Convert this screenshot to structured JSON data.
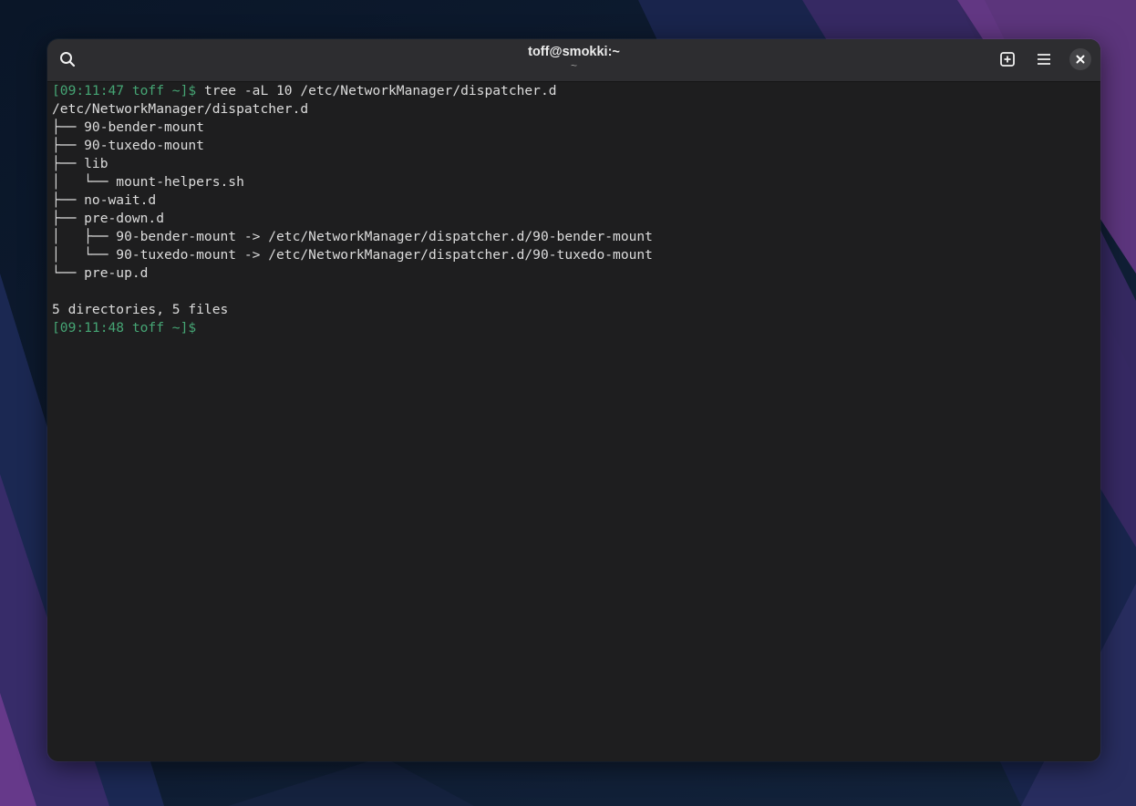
{
  "window": {
    "title": "toff@smokki:~",
    "subtitle": "~"
  },
  "titlebar": {
    "icons": [
      "search-icon",
      "new-tab-icon",
      "hamburger-menu-icon",
      "close-icon"
    ]
  },
  "colors": {
    "terminal_bg": "#1e1e1f",
    "terminal_fg": "#dcdcdc",
    "prompt": "#45a574",
    "headerbar": "#2d2d30"
  },
  "terminal": {
    "prompt1": "[09:11:47 toff ~]$",
    "command": " tree -aL 10 /etc/NetworkManager/dispatcher.d",
    "output": [
      "/etc/NetworkManager/dispatcher.d",
      "├── 90-bender-mount",
      "├── 90-tuxedo-mount",
      "├── lib",
      "│   └── mount-helpers.sh",
      "├── no-wait.d",
      "├── pre-down.d",
      "│   ├── 90-bender-mount -> /etc/NetworkManager/dispatcher.d/90-bender-mount",
      "│   └── 90-tuxedo-mount -> /etc/NetworkManager/dispatcher.d/90-tuxedo-mount",
      "└── pre-up.d",
      "",
      "5 directories, 5 files"
    ],
    "prompt2": "[09:11:48 toff ~]$"
  }
}
